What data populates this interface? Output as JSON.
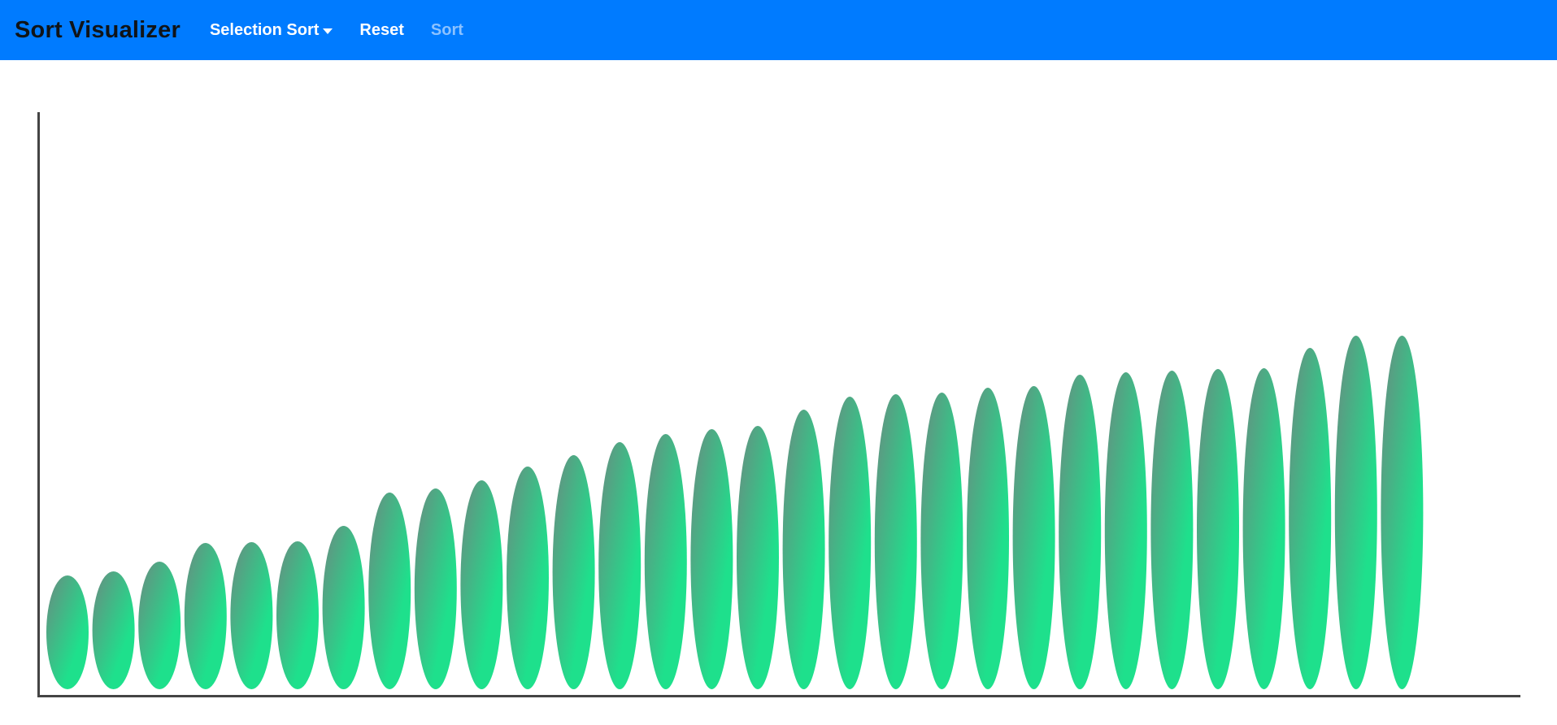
{
  "navbar": {
    "brand": "Sort Visualizer",
    "algorithm_label": "Selection Sort",
    "reset_label": "Reset",
    "sort_label": "Sort",
    "background_color": "#007bff"
  },
  "colors": {
    "bar_gradient_start": "#6a8a80",
    "bar_gradient_end": "#1ee08c",
    "axis_color": "#444444"
  },
  "chart_data": {
    "type": "bar",
    "title": "",
    "xlabel": "",
    "ylabel": "",
    "values": [
      14,
      14.5,
      15.7,
      18,
      18.1,
      18.2,
      20.1,
      24.2,
      24.7,
      25.7,
      27.4,
      28.8,
      30.4,
      31.4,
      32,
      32.4,
      34.4,
      36,
      36.3,
      36.5,
      37.1,
      37.3,
      38.7,
      39,
      39.2,
      39.4,
      39.5,
      42,
      43.5,
      43.5
    ],
    "ylim": [
      0,
      72
    ],
    "grid": false,
    "legend": false
  }
}
